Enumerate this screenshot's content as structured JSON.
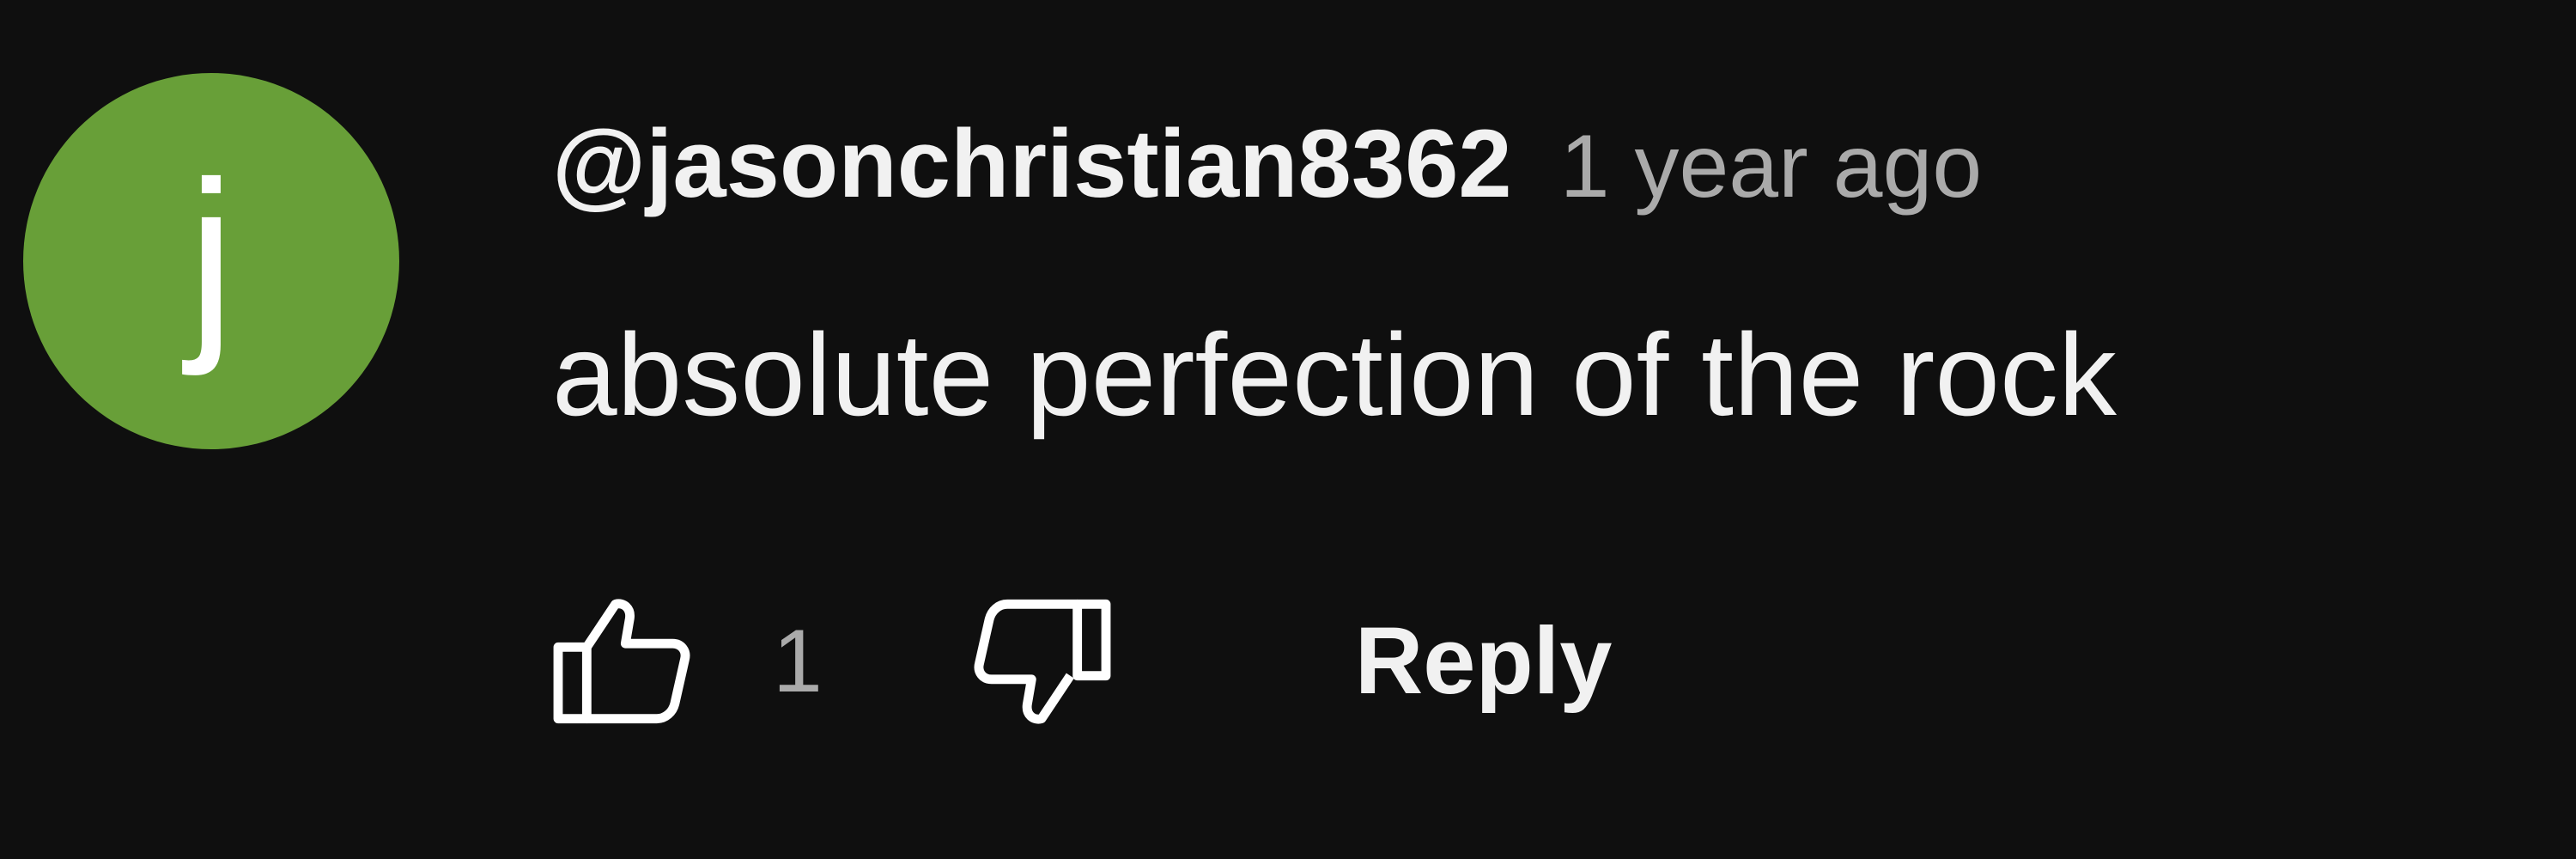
{
  "comment": {
    "avatar": {
      "letter": "j",
      "color": "#689f38"
    },
    "author": "@jasonchristian8362",
    "timestamp": "1 year ago",
    "text": "absolute perfection of the rock",
    "actions": {
      "like_icon": "thumbs-up-icon",
      "like_count": "1",
      "dislike_icon": "thumbs-down-icon",
      "reply_label": "Reply"
    }
  },
  "colors": {
    "background": "#0f0f0f",
    "primary_text": "#f1f1f1",
    "secondary_text": "#aaaaaa"
  }
}
